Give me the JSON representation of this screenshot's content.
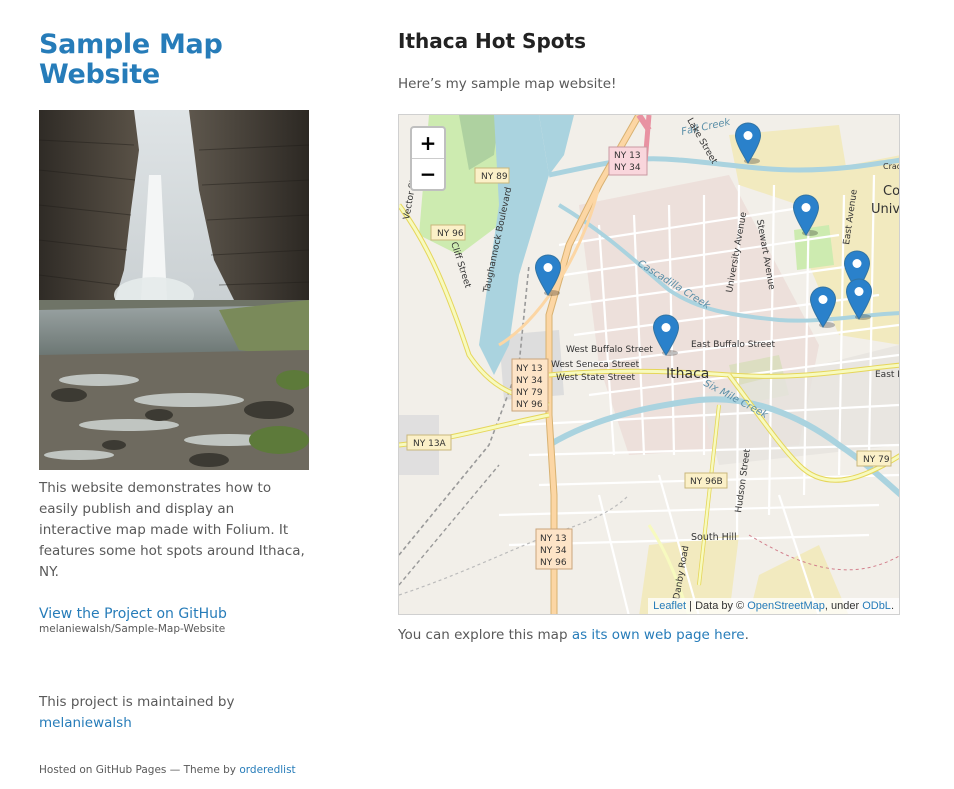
{
  "sidebar": {
    "site_title": "Sample Map Website",
    "description": "This website demonstrates how to easily publish and display an interactive map made with Folium. It features some hot spots around Ithaca, NY.",
    "github_link": "View the Project on GitHub",
    "github_repo": "melaniewalsh/Sample-Map-Website",
    "maintained_by": "This project is maintained by",
    "maintainer": "melaniewalsh",
    "hosted_prefix": "Hosted on GitHub Pages — Theme by",
    "theme_author": "orderedlist"
  },
  "main": {
    "title": "Ithaca Hot Spots",
    "intro": "Here’s my sample map website!",
    "explore_prefix": "You can explore this map",
    "explore_link": "as its own web page here",
    "explore_suffix": "."
  },
  "map": {
    "zoom_in": "+",
    "zoom_out": "−",
    "attribution": {
      "leaflet": "Leaflet",
      "data_by": " | Data by © ",
      "osm": "OpenStreetMap",
      "under": ", under ",
      "odbl": "ODbL",
      "end": "."
    },
    "labels": {
      "city": "Ithaca",
      "fall_creek": "Fall Creek",
      "cascadilla": "Cascadilla Creek",
      "six_mile": "Six Mile Creek",
      "cliff_st": "Cliff Street",
      "taughannock": "Taughannock Boulevard",
      "w_buffalo": "West Buffalo Street",
      "w_seneca": "West Seneca Street",
      "w_state": "West State Street",
      "e_buffalo": "East Buffalo Street",
      "south_hill": "South Hill",
      "danby": "Danby Road",
      "hudson": "Hudson Street",
      "univ_ave": "University Avenue",
      "stewart": "Stewart Avenue",
      "east_ave": "East Avenue",
      "lake_st": "Lake Street",
      "vector_st": "Vector Street",
      "east_l": "East I",
      "cor": "Cor",
      "univ": "Univ",
      "crad": "Crad",
      "ny96": "NY 96",
      "ny89": "NY 89",
      "ny13a": "NY 13A",
      "ny96b": "NY 96B",
      "ny79": "NY 79",
      "ny13": "NY 13",
      "ny34": "NY 34",
      "ny79c": "NY 79",
      "ny96c": "NY 96"
    },
    "markers": [
      "marker-1",
      "marker-2",
      "marker-3",
      "marker-4",
      "marker-5",
      "marker-6",
      "marker-7"
    ]
  },
  "colors": {
    "link": "#267CB9",
    "marker": "#2a81cb",
    "text": "#595959"
  }
}
